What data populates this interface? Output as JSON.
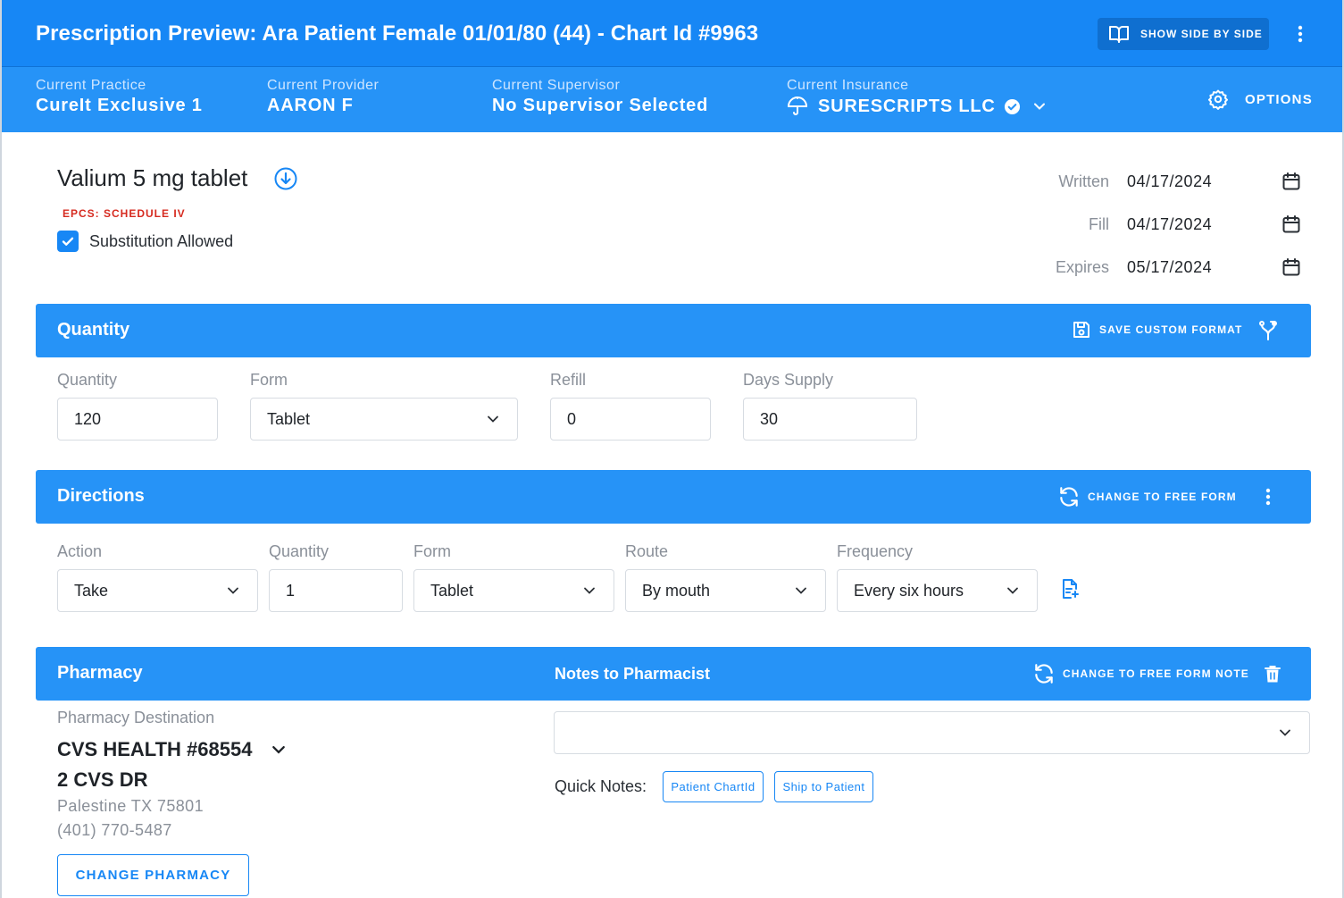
{
  "title_bar": {
    "title": "Prescription Preview: Ara Patient Female 01/01/80 (44) - Chart Id #9963",
    "side_by_side_label": "SHOW SIDE BY SIDE"
  },
  "info_bar": {
    "practice_label": "Current Practice",
    "practice_value": "CureIt Exclusive 1",
    "provider_label": "Current Provider",
    "provider_value": "AARON F",
    "supervisor_label": "Current Supervisor",
    "supervisor_value": "No Supervisor Selected",
    "insurance_label": "Current Insurance",
    "insurance_value": "SURESCRIPTS LLC",
    "options_label": "OPTIONS"
  },
  "drug": {
    "name": "Valium 5 mg tablet",
    "schedule": "EPCS: SCHEDULE IV",
    "substitution_label": "Substitution Allowed",
    "substitution_allowed": true
  },
  "dates": {
    "written_label": "Written",
    "written_value": "04/17/2024",
    "fill_label": "Fill",
    "fill_value": "04/17/2024",
    "expires_label": "Expires",
    "expires_value": "05/17/2024"
  },
  "quantity_section": {
    "title": "Quantity",
    "save_format_label": "SAVE CUSTOM FORMAT",
    "quantity_label": "Quantity",
    "quantity_value": "120",
    "form_label": "Form",
    "form_value": "Tablet",
    "refill_label": "Refill",
    "refill_value": "0",
    "days_supply_label": "Days Supply",
    "days_supply_value": "30"
  },
  "directions_section": {
    "title": "Directions",
    "change_label": "CHANGE TO FREE FORM",
    "action_label": "Action",
    "action_value": "Take",
    "quantity_label": "Quantity",
    "quantity_value": "1",
    "form_label": "Form",
    "form_value": "Tablet",
    "route_label": "Route",
    "route_value": "By mouth",
    "frequency_label": "Frequency",
    "frequency_value": "Every six hours"
  },
  "pharmacy_section": {
    "title": "Pharmacy",
    "notes_title": "Notes to Pharmacist",
    "change_note_label": "CHANGE TO FREE FORM NOTE",
    "destination_label": "Pharmacy Destination",
    "pharmacy_name": "CVS HEALTH #68554",
    "pharmacy_address": "2 CVS DR",
    "pharmacy_city": "Palestine TX 75801",
    "pharmacy_phone": "(401) 770-5487",
    "change_pharmacy_label": "CHANGE PHARMACY",
    "notes_value": "",
    "quick_notes_label": "Quick Notes:",
    "quick_notes": [
      "Patient ChartId",
      "Ship to Patient"
    ]
  },
  "colors": {
    "primary": "#1787f5",
    "section_bar": "#2693f7",
    "alert_red": "#d62b20",
    "muted_text": "#8a9099"
  }
}
